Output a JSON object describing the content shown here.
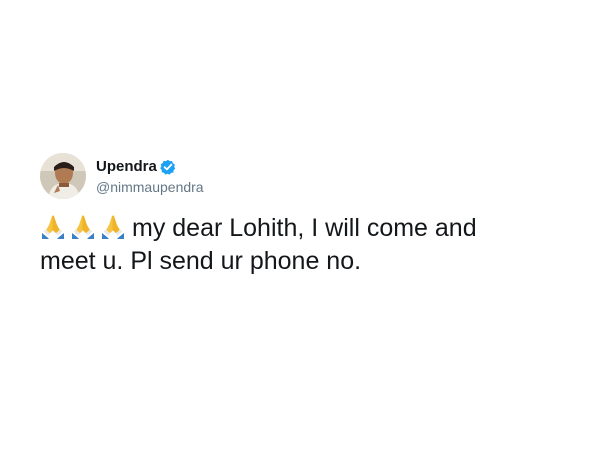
{
  "tweet": {
    "author": {
      "display_name": "Upendra",
      "handle": "@nimmaupendra",
      "verified": true,
      "avatar_icon": "profile-photo"
    },
    "emojis": [
      "folded-hands",
      "folded-hands",
      "folded-hands"
    ],
    "text_line_1": "my dear Lohith, I will come and",
    "text_line_2": "meet u. Pl send ur phone no."
  },
  "colors": {
    "name": "#14171a",
    "handle": "#657786",
    "verified_badge": "#1da1f2",
    "emoji_skin": "#f6c343",
    "emoji_sleeve": "#3b7fc4"
  }
}
